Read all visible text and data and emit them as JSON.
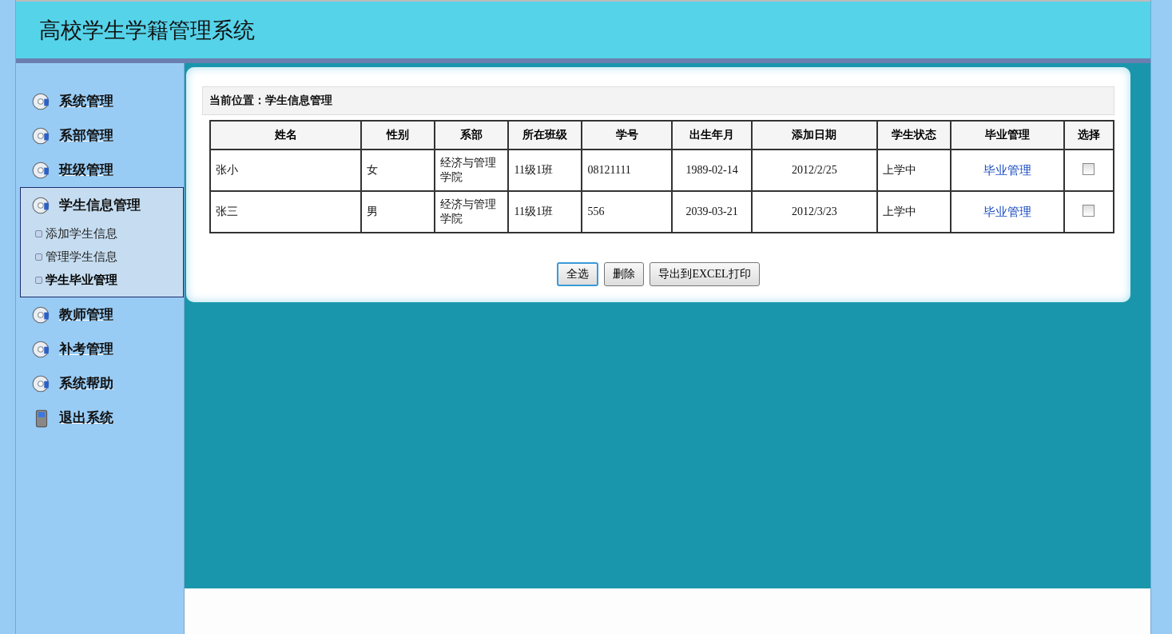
{
  "header": {
    "title": "高校学生学籍管理系统"
  },
  "sidebar": {
    "items": [
      {
        "label": "系统管理",
        "kind": "disc"
      },
      {
        "label": "系部管理",
        "kind": "disc"
      },
      {
        "label": "班级管理",
        "kind": "disc"
      },
      {
        "label": "学生信息管理",
        "kind": "disc",
        "expanded": true,
        "children": [
          {
            "label": "添加学生信息",
            "selected": false
          },
          {
            "label": "管理学生信息",
            "selected": false
          },
          {
            "label": "学生毕业管理",
            "selected": true
          }
        ]
      },
      {
        "label": "教师管理",
        "kind": "disc"
      },
      {
        "label": "补考管理",
        "kind": "disc"
      },
      {
        "label": "系统帮助",
        "kind": "disc"
      },
      {
        "label": "退出系统",
        "kind": "exit"
      }
    ]
  },
  "breadcrumb": "当前位置：学生信息管理",
  "table": {
    "columns": [
      "姓名",
      "性别",
      "系部",
      "所在班级",
      "学号",
      "出生年月",
      "添加日期",
      "学生状态",
      "毕业管理",
      "选择"
    ],
    "rows": [
      {
        "cells": [
          "张小",
          "女",
          "经济与管理学院",
          "11级1班",
          "08121111",
          "1989-02-14",
          "2012/2/25",
          "上学中"
        ],
        "action": "毕业管理",
        "checked": false
      },
      {
        "cells": [
          "张三",
          "男",
          "经济与管理学院",
          "11级1班",
          "556",
          "2039-03-21",
          "2012/3/23",
          "上学中"
        ],
        "action": "毕业管理",
        "checked": false
      }
    ]
  },
  "buttons": [
    {
      "label": "全选",
      "focused": true
    },
    {
      "label": "删除",
      "focused": false
    },
    {
      "label": "导出到EXCEL打印",
      "focused": false
    }
  ]
}
